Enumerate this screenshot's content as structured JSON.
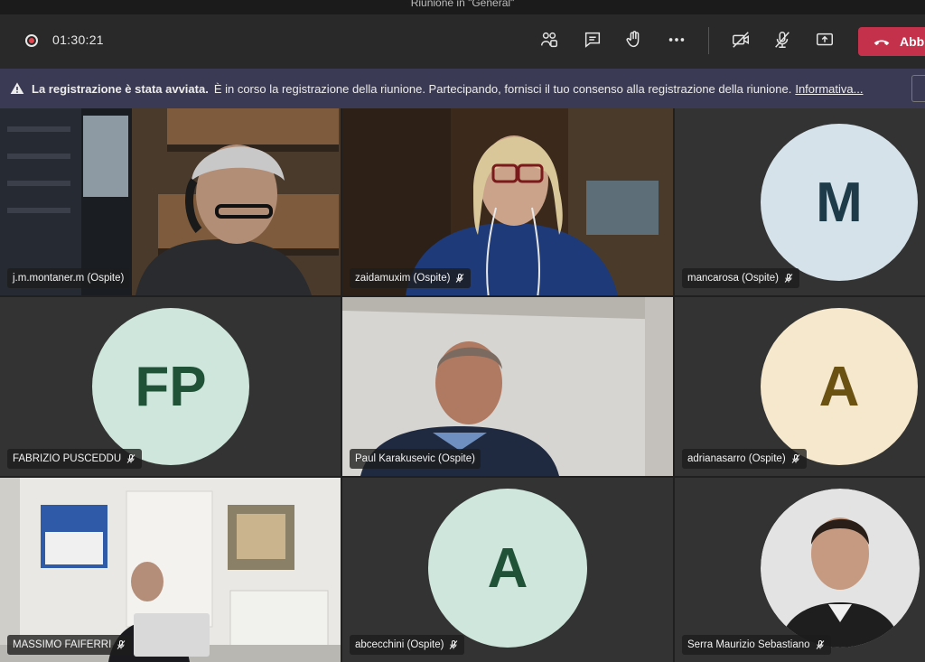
{
  "titlebar": {
    "title": "Riunione in \"General\""
  },
  "toolbar": {
    "timer": "01:30:21",
    "leave_label": "Abb"
  },
  "banner": {
    "bold": "La registrazione è stata avviata.",
    "text": "È in corso la registrazione della riunione. Partecipando, fornisci il tuo consenso alla registrazione della riunione.",
    "link": "Informativa..."
  },
  "participants": [
    {
      "name": "j.m.montaner.m (Ospite)",
      "muted": false,
      "video": true
    },
    {
      "name": "zaidamuxim (Ospite)",
      "muted": true,
      "video": true
    },
    {
      "name": "mancarosa (Ospite)",
      "muted": true,
      "initials": "M",
      "avatar_bg": "#d6e2e9",
      "avatar_fg": "#1d3b49"
    },
    {
      "name": "FABRIZIO PUSCEDDU",
      "muted": true,
      "initials": "FP",
      "avatar_bg": "#cfe6dc",
      "avatar_fg": "#1f5237"
    },
    {
      "name": "Paul Karakusevic (Ospite)",
      "muted": false,
      "video": true
    },
    {
      "name": "adrianasarro (Ospite)",
      "muted": true,
      "initials": "A",
      "avatar_bg": "#f5e8cc",
      "avatar_fg": "#6b5212"
    },
    {
      "name": "MASSIMO FAIFERRI",
      "muted": true,
      "video": true
    },
    {
      "name": "abcecchini (Ospite)",
      "muted": true,
      "initials": "A",
      "avatar_bg": "#cfe6dc",
      "avatar_fg": "#1f5237"
    },
    {
      "name": "Serra Maurizio Sebastiano",
      "muted": true,
      "photo": true
    }
  ],
  "colors": {
    "leave": "#c4314b",
    "banner": "#3a3a54",
    "toolbar": "#292929"
  }
}
